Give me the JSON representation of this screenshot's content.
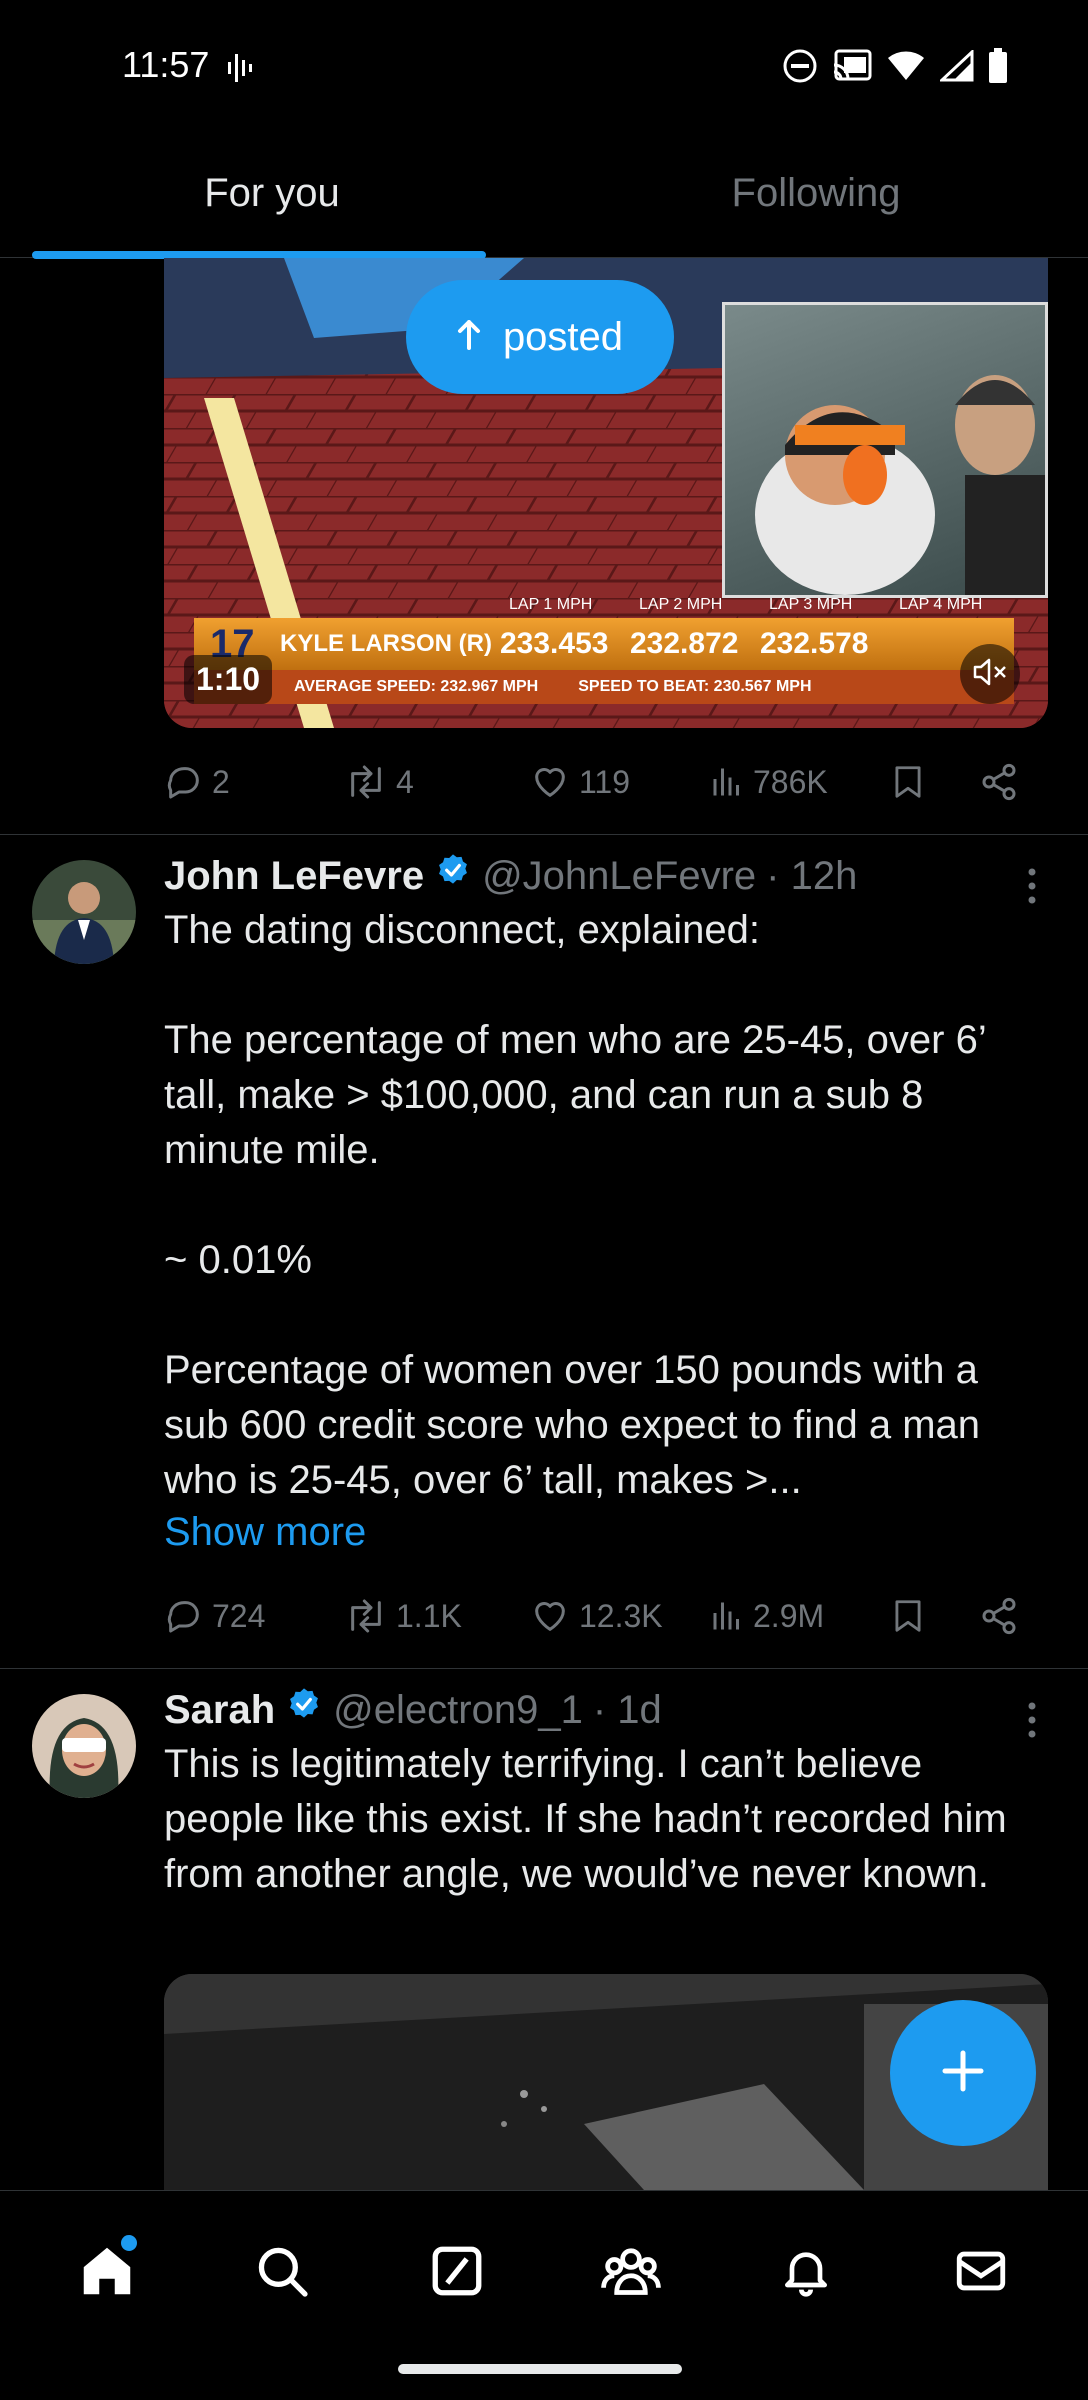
{
  "status_bar": {
    "time": "11:57"
  },
  "tabs": [
    {
      "label": "For you",
      "active": true
    },
    {
      "label": "Following",
      "active": false
    }
  ],
  "video1": {
    "posted_label": "posted",
    "duration": "1:10",
    "overlay": {
      "car_number": "17",
      "driver": "KYLE LARSON (R)",
      "laps": [
        "LAP 1 MPH",
        "LAP 2 MPH",
        "LAP 3 MPH",
        "LAP 4 MPH"
      ],
      "speeds": [
        "233.453",
        "232.872",
        "232.578"
      ],
      "avg_speed": "AVERAGE SPEED: 232.967 MPH",
      "speed_to_beat": "SPEED TO BEAT: 230.567 MPH"
    }
  },
  "post1_actions": {
    "replies": "2",
    "reposts": "4",
    "likes": "119",
    "views": "786K"
  },
  "tweet2": {
    "name": "John LeFevre",
    "handle": "@JohnLeFevre",
    "time": "· 12h",
    "text": "The dating disconnect, explained:\n\nThe percentage of men who are 25-45, over 6’ tall, make > $100,000, and can run a sub 8 minute mile.\n\n~ 0.01%\n\nPercentage of women over 150 pounds with a sub 600 credit score who expect to find a man who is 25-45, over 6’ tall, makes >...",
    "show_more": "Show more",
    "replies": "724",
    "reposts": "1.1K",
    "likes": "12.3K",
    "views": "2.9M"
  },
  "tweet3": {
    "name": "Sarah",
    "handle": "@electron9_1",
    "time": "· 1d",
    "text": "This is legitimately terrifying. I can’t believe people like this exist. If she hadn’t recorded him from another angle, we would’ve never known."
  },
  "colors": {
    "accent": "#1d9bf0",
    "background": "#000000",
    "muted": "#71767b"
  }
}
